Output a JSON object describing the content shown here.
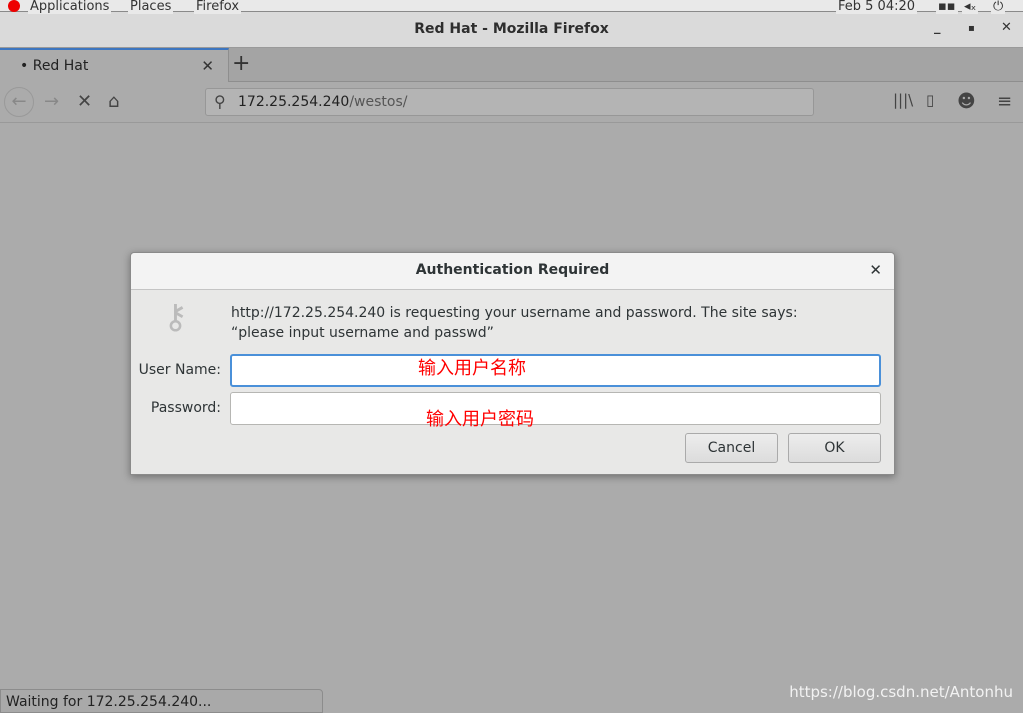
{
  "system_bar": {
    "applications": "Applications",
    "places": "Places",
    "firefox": "Firefox",
    "clock": "Feb 5 04:20"
  },
  "window": {
    "title": "Red Hat - Mozilla Firefox"
  },
  "tabs": [
    {
      "label": "Red Hat",
      "active": true
    }
  ],
  "address_bar": {
    "host": "172.25.254.240",
    "path": "/westos/"
  },
  "dialog": {
    "title": "Authentication Required",
    "message": "http://172.25.254.240 is requesting your username and password. The site says: “please input username and passwd”",
    "username_label": "User Name:",
    "username_value": "",
    "password_label": "Password:",
    "password_value": "",
    "cancel_label": "Cancel",
    "ok_label": "OK"
  },
  "annotations": {
    "username_note": "输入用户名称",
    "password_note": "输入用户密码"
  },
  "status_text": "Waiting for 172.25.254.240...",
  "watermark": "https://blog.csdn.net/Antonhu",
  "colors": {
    "accent": "#4a90d9",
    "annotation": "#ff0000",
    "tab_indicator": "#3d76c0"
  }
}
